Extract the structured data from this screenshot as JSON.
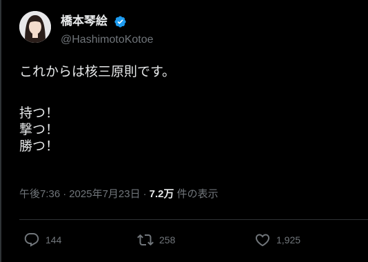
{
  "author": {
    "display_name": "橋本琴絵",
    "handle": "@HashimotoKotoe",
    "verified": true,
    "verified_color": "#1d9bf0"
  },
  "tweet": {
    "lines": [
      "これからは核三原則です。"
    ],
    "lines_after_gap": [
      "持つ！",
      "撃つ！",
      "勝つ！"
    ]
  },
  "meta": {
    "time": "午後7:36",
    "date": "2025年7月23日",
    "views_count": "7.2万",
    "views_label": "件の表示",
    "separator": "·"
  },
  "actions": {
    "reply_count": "144",
    "retweet_count": "258",
    "like_count": "1,925"
  },
  "colors": {
    "background": "#000000",
    "text_primary": "#e7e9ea",
    "text_secondary": "#71767b",
    "border": "#2f3336"
  }
}
